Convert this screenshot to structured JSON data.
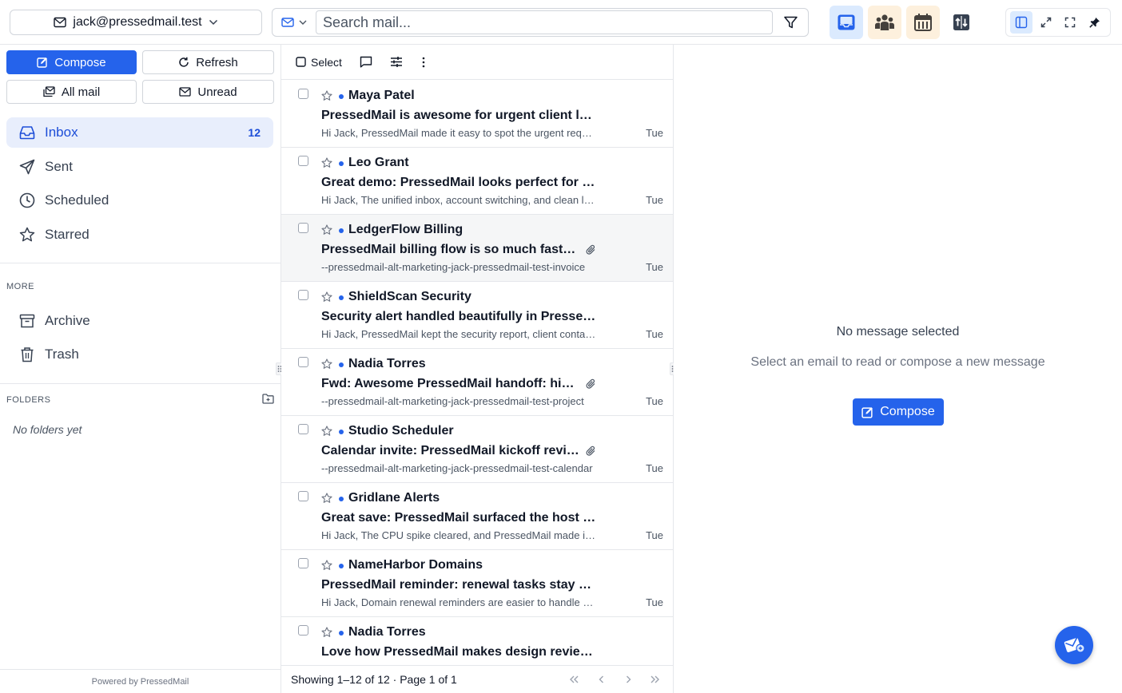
{
  "account": {
    "email": "jack@pressedmail.test"
  },
  "search": {
    "placeholder": "Search mail..."
  },
  "colors": {
    "accent": "#2563eb",
    "accent_light": "#dbeafe",
    "app_bg_warm": "#fdf0dd"
  },
  "apps": [
    {
      "name": "mail",
      "icon": "inbox-tray-icon",
      "active": true
    },
    {
      "name": "contacts",
      "icon": "people-icon",
      "active": false
    },
    {
      "name": "calendar",
      "icon": "calendar-icon",
      "active": false
    },
    {
      "name": "notes",
      "icon": "notes-icon",
      "active": false
    }
  ],
  "sidebar": {
    "compose_label": "Compose",
    "refresh_label": "Refresh",
    "all_mail_label": "All mail",
    "unread_label": "Unread",
    "nav": [
      {
        "label": "Inbox",
        "count": "12",
        "icon": "inbox-icon"
      },
      {
        "label": "Sent",
        "icon": "send-icon"
      },
      {
        "label": "Scheduled",
        "icon": "clock-icon"
      },
      {
        "label": "Starred",
        "icon": "star-icon"
      }
    ],
    "more_heading": "MORE",
    "more": [
      {
        "label": "Archive",
        "icon": "archive-icon"
      },
      {
        "label": "Trash",
        "icon": "trash-icon"
      }
    ],
    "folders_heading": "FOLDERS",
    "no_folders": "No folders yet",
    "powered_by": "Powered by PressedMail"
  },
  "list": {
    "select_label": "Select",
    "messages": [
      {
        "sender": "Maya Patel",
        "subject": "PressedMail is awesome for urgent client launches",
        "preview": "Hi Jack, PressedMail made it easy to spot the urgent request",
        "date": "Tue",
        "unread": true,
        "attachment": false
      },
      {
        "sender": "Leo Grant",
        "subject": "Great demo: PressedMail looks perfect for the team",
        "preview": "Hi Jack, The unified inbox, account switching, and clean layout",
        "date": "Tue",
        "unread": true,
        "attachment": false
      },
      {
        "sender": "LedgerFlow Billing",
        "subject": "PressedMail billing flow is so much faster now",
        "preview": "--pressedmail-alt-marketing-jack-pressedmail-test-invoice",
        "date": "Tue",
        "unread": true,
        "attachment": true
      },
      {
        "sender": "ShieldScan Security",
        "subject": "Security alert handled beautifully in PressedMail",
        "preview": "Hi Jack, PressedMail kept the security report, client contacts",
        "date": "Tue",
        "unread": true,
        "attachment": false
      },
      {
        "sender": "Nadia Torres",
        "subject": "Fwd: Awesome PressedMail handoff: highlights",
        "preview": "--pressedmail-alt-marketing-jack-pressedmail-test-project",
        "date": "Tue",
        "unread": true,
        "attachment": true
      },
      {
        "sender": "Studio Scheduler",
        "subject": "Calendar invite: PressedMail kickoff review",
        "preview": "--pressedmail-alt-marketing-jack-pressedmail-test-calendar",
        "date": "Tue",
        "unread": true,
        "attachment": true
      },
      {
        "sender": "Gridlane Alerts",
        "subject": "Great save: PressedMail surfaced the host alert",
        "preview": "Hi Jack, The CPU spike cleared, and PressedMail made it clear",
        "date": "Tue",
        "unread": true,
        "attachment": false
      },
      {
        "sender": "NameHarbor Domains",
        "subject": "PressedMail reminder: renewal tasks stay organized",
        "preview": "Hi Jack, Domain renewal reminders are easier to handle now",
        "date": "Tue",
        "unread": true,
        "attachment": false
      },
      {
        "sender": "Nadia Torres",
        "subject": "Love how PressedMail makes design reviews easy",
        "preview": "",
        "date": "",
        "unread": true,
        "attachment": false
      }
    ],
    "pager": "Showing 1–12 of 12 · Page 1 of 1"
  },
  "reader": {
    "empty_title": "No message selected",
    "empty_subtitle": "Select an email to read or compose a new message",
    "compose_label": "Compose"
  }
}
